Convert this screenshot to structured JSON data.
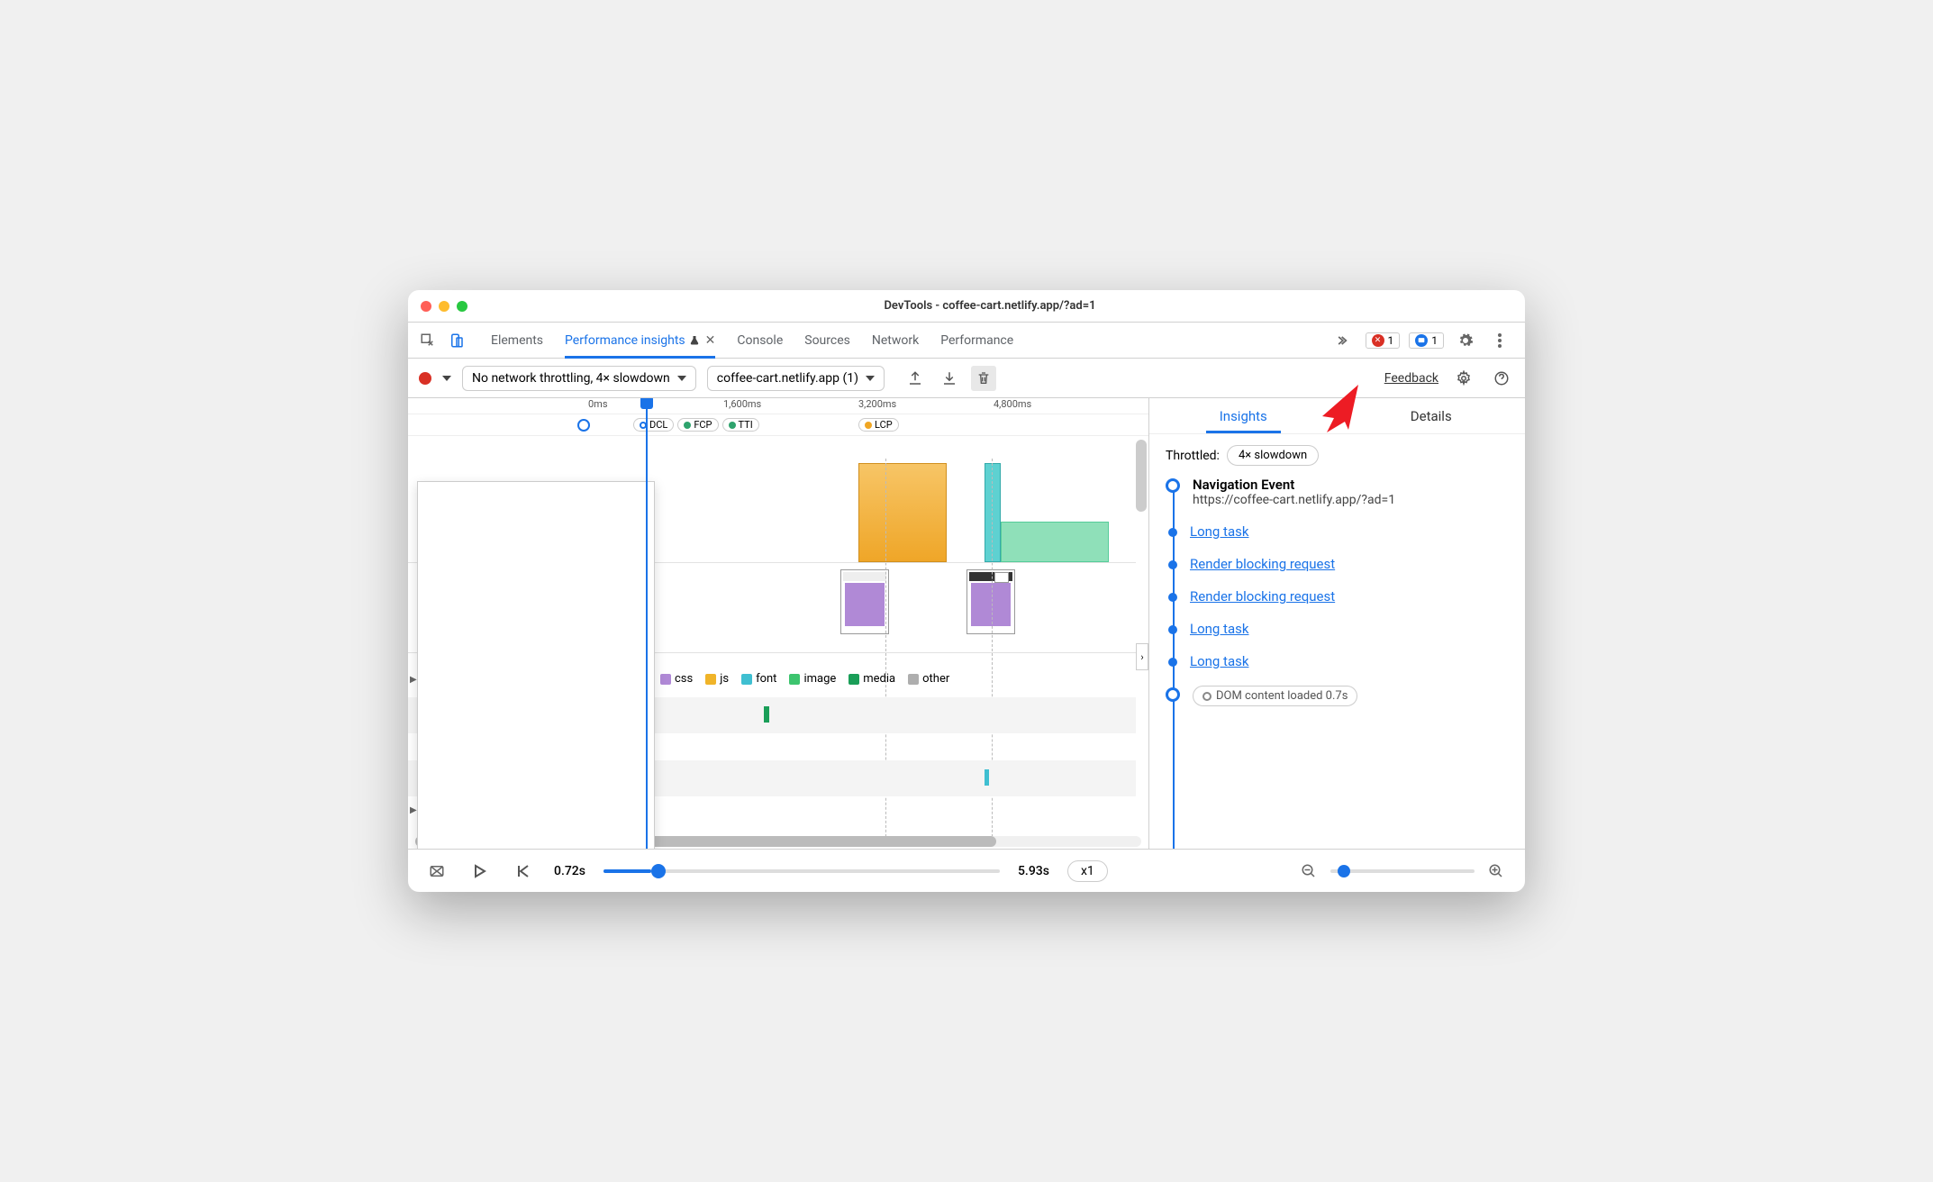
{
  "window": {
    "title": "DevTools - coffee-cart.netlify.app/?ad=1"
  },
  "tabs": {
    "elements": "Elements",
    "perf_insights": "Performance insights",
    "console": "Console",
    "sources": "Sources",
    "network": "Network",
    "performance": "Performance"
  },
  "badges": {
    "errors": "1",
    "info": "1"
  },
  "toolbar": {
    "throttling": "No network throttling, 4× slowdown",
    "recording": "coffee-cart.netlify.app (1)",
    "feedback": "Feedback"
  },
  "ruler": {
    "t0": "0ms",
    "t1": "1,600ms",
    "t2": "3,200ms",
    "t3": "4,800ms"
  },
  "markers": {
    "dcl": "DCL",
    "fcp": "FCP",
    "tti": "TTI",
    "lcp": "LCP"
  },
  "legend": {
    "css": "css",
    "js": "js",
    "font": "font",
    "image": "image",
    "media": "media",
    "other": "other"
  },
  "colors": {
    "css": "#b089d6",
    "js": "#f0b429",
    "font": "#3fbfd1",
    "image": "#3cc46e",
    "media": "#1a9e58",
    "other": "#aeaeae",
    "blue": "#1a73e8",
    "red": "#d93025",
    "orange": "#f0a623",
    "yellow": "#f0b429",
    "teal": "#5ed1d1",
    "green": "#6ad38a"
  },
  "insights": {
    "tab_insights": "Insights",
    "tab_details": "Details",
    "throttled_label": "Throttled:",
    "throttled_value": "4× slowdown",
    "nav_title": "Navigation Event",
    "nav_url": "https://coffee-cart.netlify.app/?ad=1",
    "items": {
      "a": "Long task",
      "b": "Render blocking request",
      "c": "Render blocking request",
      "d": "Long task",
      "e": "Long task"
    },
    "dcl_pill": "DOM content loaded 0.7s"
  },
  "footer": {
    "current": "0.72s",
    "total": "5.93s",
    "speed": "x1"
  }
}
